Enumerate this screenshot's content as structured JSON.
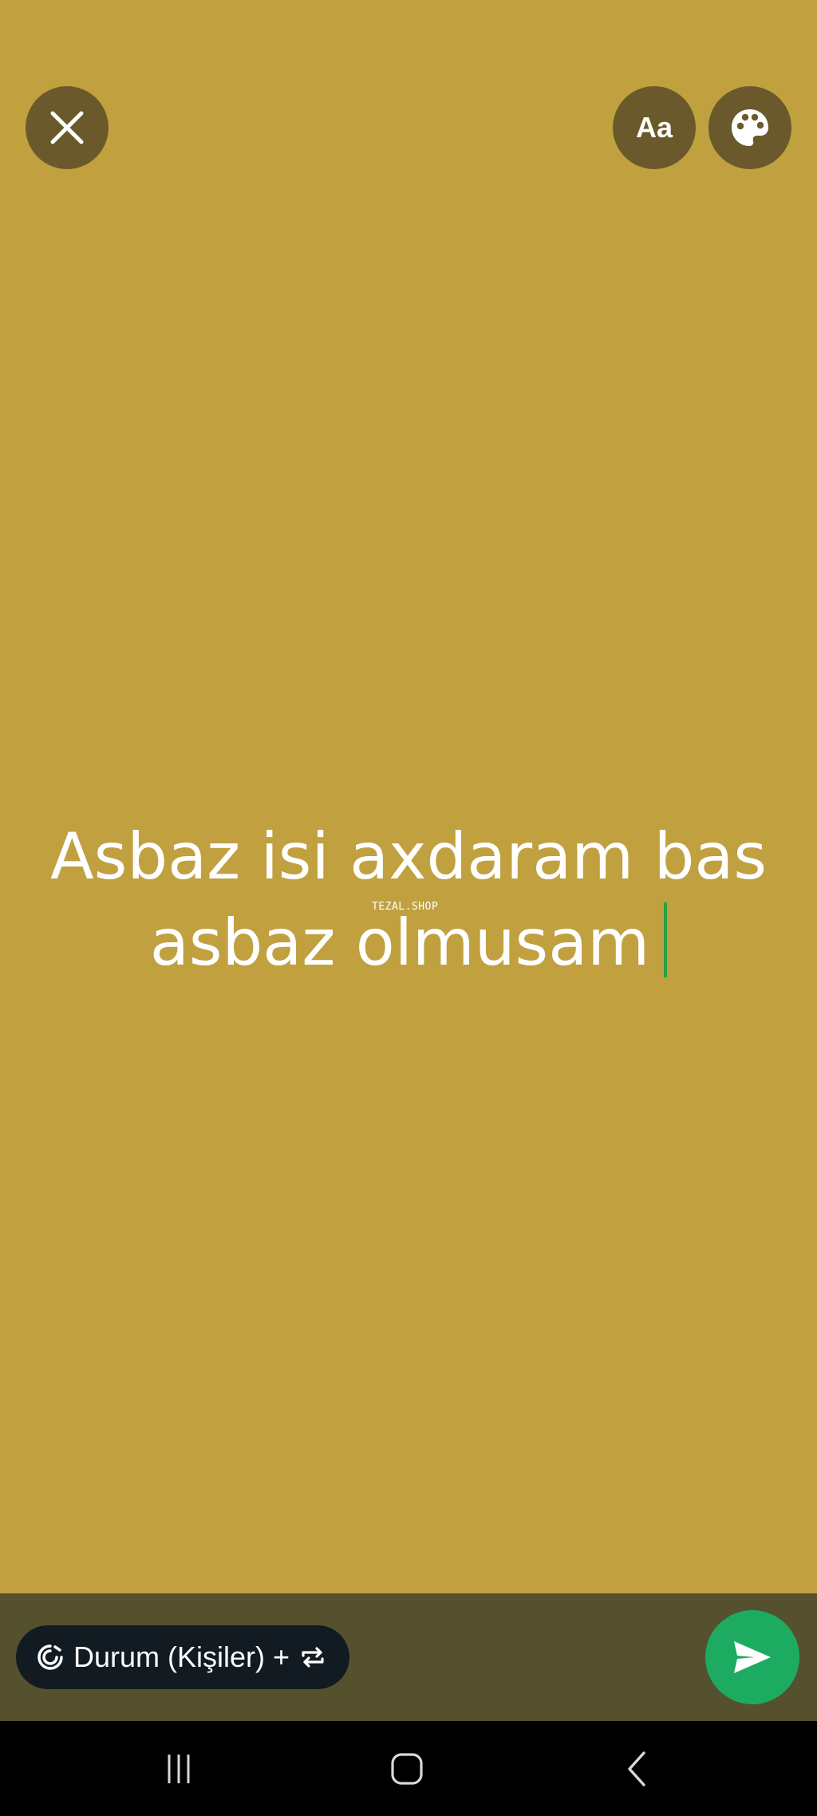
{
  "top_controls": {
    "close_icon": "close-icon",
    "font_button_label": "Aa",
    "palette_icon": "palette-icon"
  },
  "status_text": {
    "line1": "Asbaz isi axdaram bas",
    "line2": "asbaz olmusam"
  },
  "watermark": "TEZAL.SHOP",
  "bottom_bar": {
    "audience_label": "Durum (Kişiler) +",
    "audience_icon": "status-ring-icon",
    "switch_icon": "repeat-icon",
    "send_icon": "send-icon"
  },
  "nav": {
    "recents_icon": "recents-icon",
    "home_icon": "home-icon",
    "back_icon": "back-icon"
  },
  "colors": {
    "background": "#c1a03f",
    "button_bg": "#6a5a2b",
    "bottom_bar_bg": "#55502e",
    "pill_bg": "#111b21",
    "send_green": "#1dab61",
    "cursor_green": "#25a244"
  }
}
